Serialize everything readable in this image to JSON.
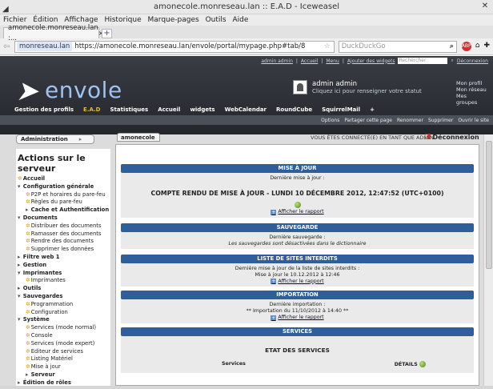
{
  "window": {
    "title": "amonecole.monreseau.lan :: E.A.D - Iceweasel",
    "close": "✕"
  },
  "menu": [
    "Fichier",
    "Édition",
    "Affichage",
    "Historique",
    "Marque-pages",
    "Outils",
    "Aide"
  ],
  "tabs": [
    {
      "label": "amonecole.monreseau.lan :..."
    }
  ],
  "new_tab": "+",
  "address": {
    "site": "monreseau.lan",
    "url": "https://amonecole.monreseau.lan/envole/portal/mypage.php#tab/8"
  },
  "search": {
    "placeholder": "DuckDuckGo"
  },
  "envole": {
    "logo": "envole",
    "top_links": [
      "admin admin",
      "Accueil",
      "Menu",
      "Ajouter des widgets"
    ],
    "search_placeholder": "Rechercher",
    "logout_top": "Déconnexion",
    "user": {
      "name": "admin admin",
      "hint": "Cliquez ici pour renseigner votre statut"
    },
    "profile_links": [
      "Mon profil",
      "Mon réseau",
      "Mes groupes"
    ],
    "main_nav": [
      "Gestion des profils",
      "E.A.D",
      "Statistiques",
      "Accueil",
      "widgets",
      "WebCalendar",
      "RoundCube",
      "SquirrelMail",
      "+"
    ],
    "active_nav": "E.A.D",
    "sub_nav": [
      "Options",
      "Partager cette page",
      "Renommer",
      "Supprimer",
      "Ouvrir le site"
    ]
  },
  "left": {
    "tab": "Administration",
    "heading": "Actions sur le serveur",
    "tree": [
      {
        "label": "Accueil",
        "level": 0,
        "icon": true
      },
      {
        "label": "Configuration générale",
        "level": 0,
        "expanded": true
      },
      {
        "label": "P2P et horaires du pare-feu",
        "level": 1,
        "icon": true
      },
      {
        "label": "Règles du pare-feu",
        "level": 1,
        "icon": true
      },
      {
        "label": "Cache et Authentification",
        "level": 1,
        "collapsed": true
      },
      {
        "label": "Documents",
        "level": 0,
        "expanded": true
      },
      {
        "label": "Distribuer des documents",
        "level": 1,
        "icon": true
      },
      {
        "label": "Ramasser des documents",
        "level": 1,
        "icon": true
      },
      {
        "label": "Rendre des documents",
        "level": 1,
        "icon": true
      },
      {
        "label": "Supprimer les données",
        "level": 1,
        "icon": true
      },
      {
        "label": "Filtre web 1",
        "level": 0,
        "collapsed": true
      },
      {
        "label": "Gestion",
        "level": 0,
        "collapsed": true
      },
      {
        "label": "Imprimantes",
        "level": 0,
        "expanded": true
      },
      {
        "label": "Imprimantes",
        "level": 1,
        "icon": true
      },
      {
        "label": "Outils",
        "level": 0,
        "collapsed": true
      },
      {
        "label": "Sauvegardes",
        "level": 0,
        "expanded": true
      },
      {
        "label": "Programmation",
        "level": 1,
        "icon": true
      },
      {
        "label": "Configuration",
        "level": 1,
        "icon": true
      },
      {
        "label": "Système",
        "level": 0,
        "expanded": true
      },
      {
        "label": "Services (mode normal)",
        "level": 1,
        "icon": true
      },
      {
        "label": "Console",
        "level": 1,
        "icon": true
      },
      {
        "label": "Services (mode expert)",
        "level": 1,
        "icon": true
      },
      {
        "label": "Editeur de services",
        "level": 1,
        "icon": true
      },
      {
        "label": "Listing Matériel",
        "level": 1,
        "icon": true
      },
      {
        "label": "Mise à jour",
        "level": 1,
        "icon": true
      },
      {
        "label": "Serveur",
        "level": 1,
        "collapsed": true
      },
      {
        "label": "Édition de rôles",
        "level": 0,
        "collapsed": true
      }
    ]
  },
  "main": {
    "tab": "amonecole",
    "connected": "VOUS ÊTES CONNECTÉ(E) EN TANT QUE ADMIN",
    "logout": "Déconnexion",
    "maj": {
      "title": "MISE À JOUR",
      "last": "Dernière mise à jour :",
      "report": "COMPTE RENDU DE MISE À JOUR - LUNDI 10 DÉCEMBRE 2012, 12:47:52 (UTC+0100)",
      "link": "Afficher le rapport"
    },
    "sauvegarde": {
      "title": "SAUVEGARDE",
      "last": "Dernière sauvegarde :",
      "note": "Les sauvegardes sont désactivées dans le dictionnaire"
    },
    "sites": {
      "title": "LISTE DE SITES INTERDITS",
      "line1": "Dernière mise à jour de la liste de sites interdits :",
      "line2": "Mise à jour le 10.12.2012 à 12:46",
      "link": "Afficher le rapport"
    },
    "importation": {
      "title": "IMPORTATION",
      "last": "Dernière importation :",
      "line": "** Importation du 11/10/2012 à 14:40 **",
      "link": "Afficher le rapport"
    },
    "services": {
      "title": "SERVICES",
      "etat": "ETAT DES SERVICES",
      "col1": "Services",
      "col2": "DÉTAILS"
    }
  }
}
